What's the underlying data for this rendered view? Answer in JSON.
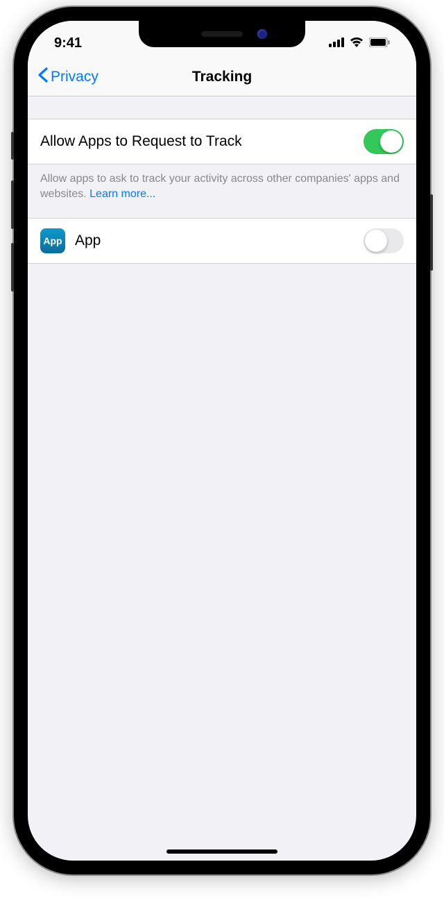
{
  "statusbar": {
    "time": "9:41"
  },
  "navbar": {
    "back_label": "Privacy",
    "title": "Tracking"
  },
  "settings": {
    "allow_tracking": {
      "label": "Allow Apps to Request to Track",
      "on": true
    },
    "footer_text": "Allow apps to ask to track your activity across other companies' apps and websites. ",
    "learn_more_label": "Learn more...",
    "app_row": {
      "icon_text": "App",
      "label": "App",
      "on": false
    }
  }
}
